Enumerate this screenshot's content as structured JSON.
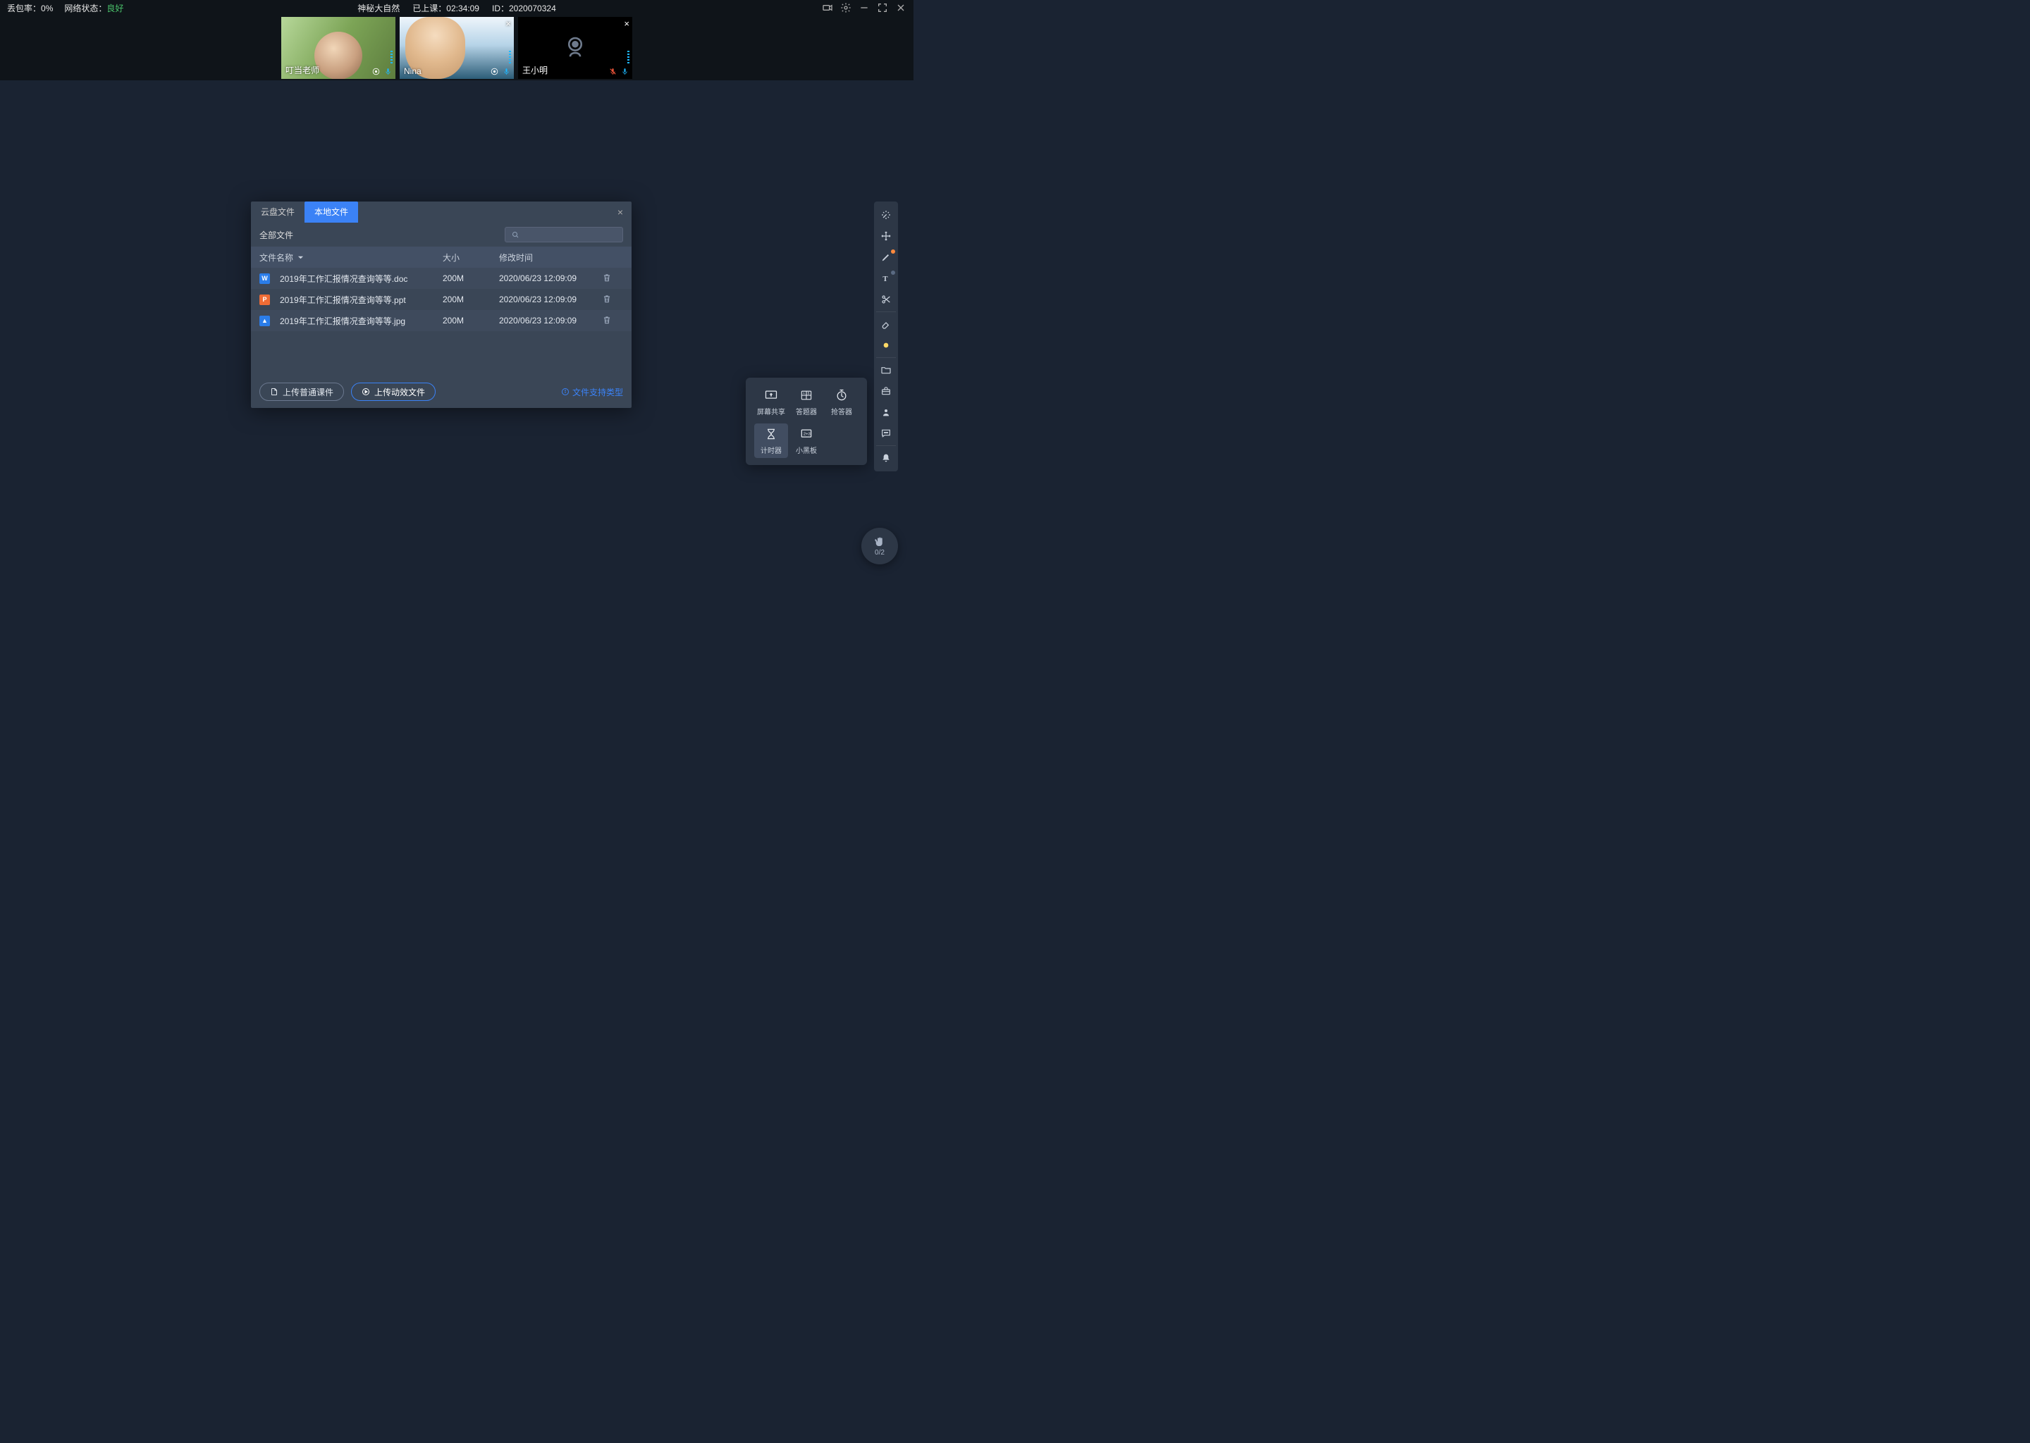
{
  "topbar": {
    "packet_loss_label": "丢包率：",
    "packet_loss_value": "0%",
    "network_label": "网络状态：",
    "network_value": "良好",
    "course_title": "神秘大自然",
    "elapsed_label": "已上课：",
    "elapsed_value": "02:34:09",
    "id_label": "ID：",
    "id_value": "2020070324"
  },
  "videos": [
    {
      "name": "叮当老师",
      "show_close": false,
      "mic_muted": false
    },
    {
      "name": "Nina",
      "show_close": true,
      "mic_muted": false
    },
    {
      "name": "王小明",
      "show_close": true,
      "mic_muted": true
    }
  ],
  "file_dialog": {
    "tabs": {
      "cloud": "云盘文件",
      "local": "本地文件"
    },
    "all_files": "全部文件",
    "columns": {
      "name": "文件名称",
      "size": "大小",
      "modified": "修改时间"
    },
    "rows": [
      {
        "icon": "doc",
        "name": "2019年工作汇报情况查询等等.doc",
        "size": "200M",
        "time": "2020/06/23 12:09:09"
      },
      {
        "icon": "ppt",
        "name": "2019年工作汇报情况查询等等.ppt",
        "size": "200M",
        "time": "2020/06/23 12:09:09"
      },
      {
        "icon": "img",
        "name": "2019年工作汇报情况查询等等.jpg",
        "size": "200M",
        "time": "2020/06/23 12:09:09"
      }
    ],
    "upload_normal": "上传普通课件",
    "upload_animated": "上传动效文件",
    "support_hint": "文件支持类型"
  },
  "tool_popup": {
    "screen_share": "屏幕共享",
    "answer": "答题器",
    "responder": "抢答器",
    "timer": "计时器",
    "blackboard": "小黑板"
  },
  "hand": {
    "count": "0/2"
  }
}
